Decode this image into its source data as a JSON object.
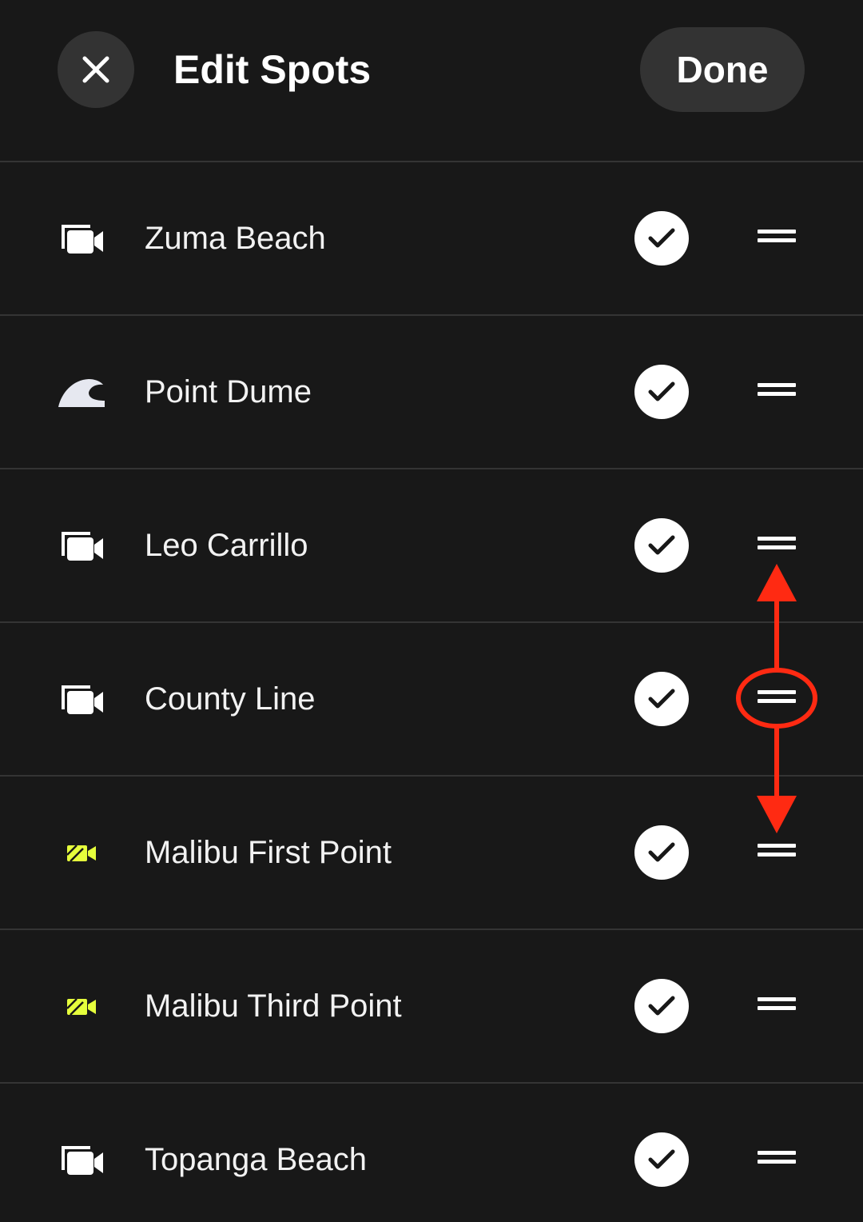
{
  "header": {
    "title": "Edit Spots",
    "done_label": "Done",
    "close_icon": "close-icon"
  },
  "spots": [
    {
      "name": "Zuma Beach",
      "icon": "camera-icon",
      "checked": true
    },
    {
      "name": "Point Dume",
      "icon": "wave-icon",
      "checked": true
    },
    {
      "name": "Leo Carrillo",
      "icon": "camera-icon",
      "checked": true
    },
    {
      "name": "County Line",
      "icon": "camera-icon",
      "checked": true
    },
    {
      "name": "Malibu First Point",
      "icon": "premium-camera-icon",
      "checked": true
    },
    {
      "name": "Malibu Third Point",
      "icon": "premium-camera-icon",
      "checked": true
    },
    {
      "name": "Topanga Beach",
      "icon": "camera-icon",
      "checked": true
    }
  ],
  "colors": {
    "background": "#181818",
    "button_bg": "#333333",
    "divider": "#343434",
    "premium_icon": "#e6ff3c",
    "annotation": "#ff2a12"
  }
}
